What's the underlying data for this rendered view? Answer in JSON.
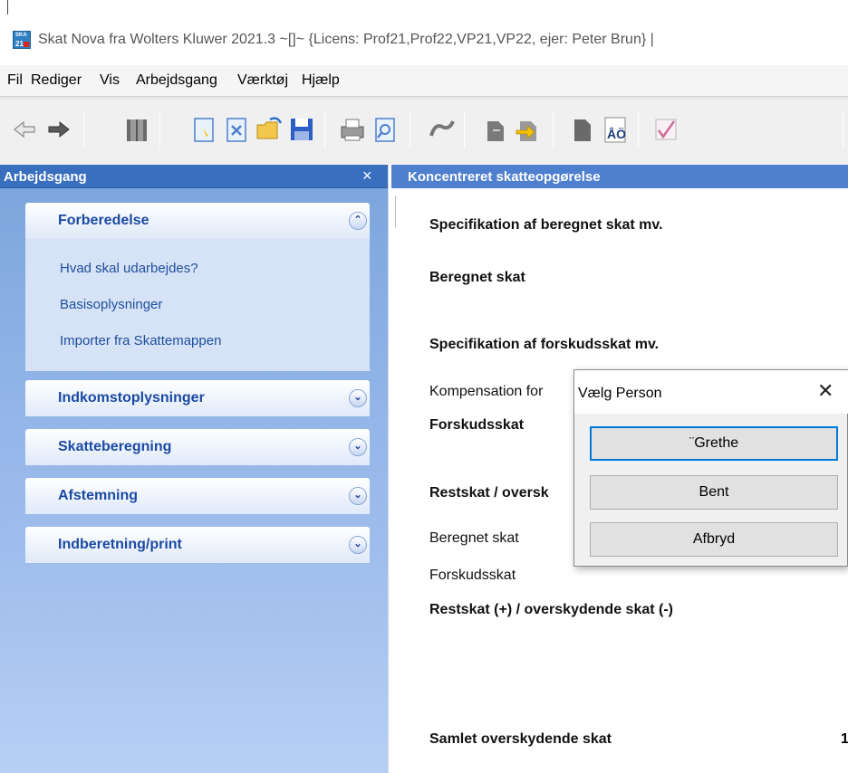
{
  "titlebar": {
    "icon_text_top": "SKA",
    "icon_text_bottom": "21",
    "title": "Skat Nova fra Wolters Kluwer 2021.3  ~[]~   {Licens: Prof21,Prof22,VP21,VP22, ejer: Peter Brun}  |"
  },
  "menu": [
    "Fil",
    "Rediger",
    "Vis",
    "Arbejdsgang",
    "Værktøj",
    "Hjælp"
  ],
  "toolbar": {
    "icons": [
      "back-arrow-icon",
      "forward-arrow-icon",
      "book-icon",
      "new-document-icon",
      "close-document-icon",
      "open-folder-icon",
      "save-icon",
      "print-icon",
      "print-preview-icon",
      "link-icon",
      "export-icon",
      "import-icon",
      "document-icon",
      "font-ao-icon",
      "check-chart-icon"
    ]
  },
  "left_panel": {
    "title": "Arbejdsgang",
    "close": "×",
    "groups": [
      {
        "label": "Forberedelse",
        "expanded": true,
        "links": [
          "Hvad skal udarbejdes?",
          "Basisoplysninger",
          "Importer fra Skattemappen"
        ]
      },
      {
        "label": "Indkomstoplysninger",
        "expanded": false
      },
      {
        "label": "Skatteberegning",
        "expanded": false
      },
      {
        "label": "Afstemning",
        "expanded": false
      },
      {
        "label": "Indberetning/print",
        "expanded": false
      }
    ]
  },
  "main": {
    "title": "Koncentreret skatteopgørelse",
    "rows": [
      {
        "text": "Specifikation af beregnet skat mv.",
        "bold": true
      },
      {
        "text": "Beregnet skat",
        "bold": true
      },
      {
        "text": "Specifikation af forskudsskat mv.",
        "bold": true
      },
      {
        "text": "Kompensation for",
        "bold": false
      },
      {
        "text": "Forskudsskat",
        "bold": true
      },
      {
        "text": "Restskat / oversk",
        "bold": true
      },
      {
        "text": "Beregnet skat",
        "bold": false
      },
      {
        "text": "Forskudsskat",
        "bold": false
      },
      {
        "text": "Restskat (+) / overskydende skat (-)",
        "bold": true
      },
      {
        "text": "Samlet overskydende skat",
        "bold": true
      }
    ],
    "edge_value": "1"
  },
  "dialog": {
    "title": "Vælg Person",
    "close": "✕",
    "buttons": [
      "¨Grethe",
      "Bent",
      "Afbryd"
    ]
  },
  "colors": {
    "panel_header": "#3a6fc0",
    "group_label": "#1b4aa3",
    "focus_border": "#0078d7"
  }
}
